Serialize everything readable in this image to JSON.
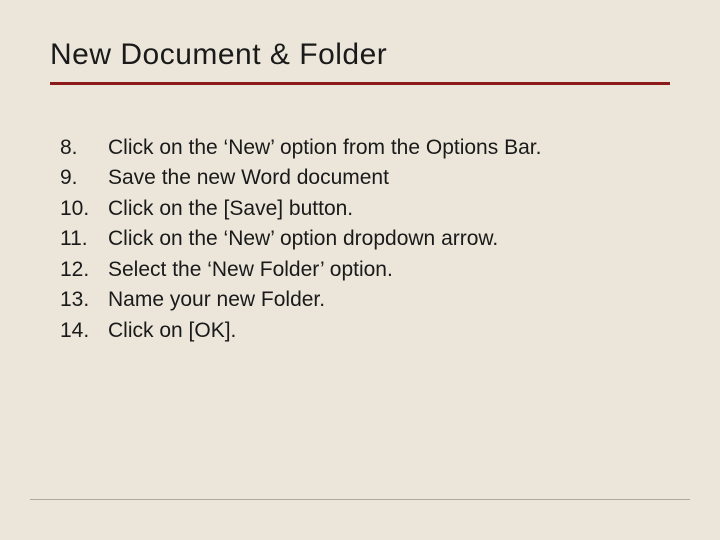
{
  "title": "New Document & Folder",
  "items": [
    {
      "n": "8.",
      "text": "Click on the ‘New’ option from the Options Bar."
    },
    {
      "n": "9.",
      "text": "Save the new Word document"
    },
    {
      "n": "10.",
      "text": "Click on the [Save] button."
    },
    {
      "n": "11.",
      "text": "Click on the ‘New’ option dropdown arrow."
    },
    {
      "n": "12.",
      "text": "Select the ‘New Folder’ option."
    },
    {
      "n": "13.",
      "text": "Name your new Folder."
    },
    {
      "n": "14.",
      "text": "Click on [OK]."
    }
  ]
}
